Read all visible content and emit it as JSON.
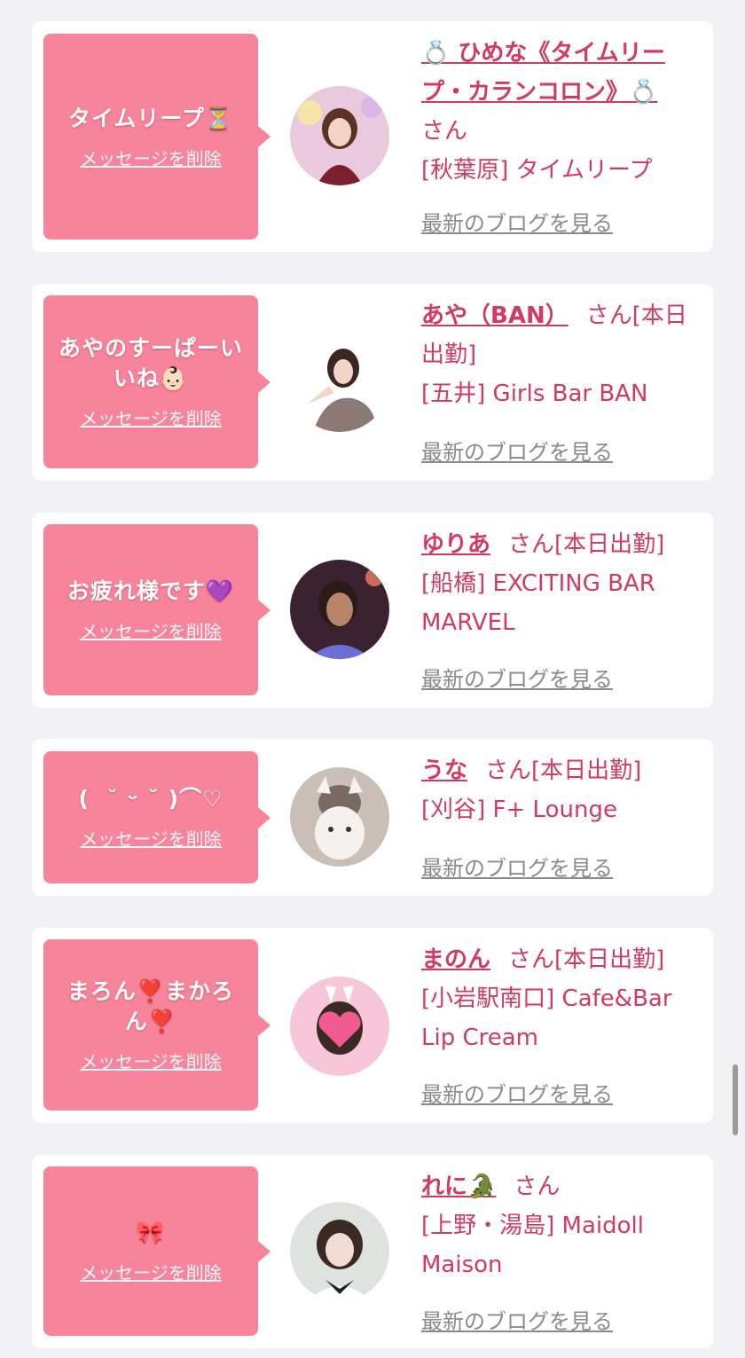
{
  "delete_label": "メッセージを削除",
  "blog_label": "最新のブログを見る",
  "san_label": "さん",
  "cards": [
    {
      "message": "タイムリープ⏳",
      "name": "💍 ひめな《タイムリープ・カランコロン》💍",
      "status": "",
      "shop": "[秋葉原] タイムリープ"
    },
    {
      "message": "あやのすーぱーいいね👶🏻",
      "name": "あや（BAN）",
      "status": "[本日出勤]",
      "shop": "[五井] Girls Bar BAN"
    },
    {
      "message": "お疲れ様です💜",
      "name": "ゆりあ",
      "status": "[本日出勤]",
      "shop": "[船橋] EXCITING BAR MARVEL"
    },
    {
      "message": "( ︎ ˘ ᵕ ˘ ︎)⌒♡",
      "name": "うな",
      "status": "[本日出勤]",
      "shop": "[刈谷] F+ Lounge"
    },
    {
      "message": "まろん❣️まかろん❣️",
      "name": "まのん",
      "status": "[本日出勤]",
      "shop": "[小岩駅南口] Cafe&Bar Lip Cream"
    },
    {
      "message": "🎀",
      "name": "れに🐊",
      "status": "",
      "shop": "[上野・湯島] Maidoll Maison"
    }
  ],
  "colors": {
    "bubble": "#f7849a",
    "accent": "#d33a62",
    "background": "#f2f2f4"
  }
}
